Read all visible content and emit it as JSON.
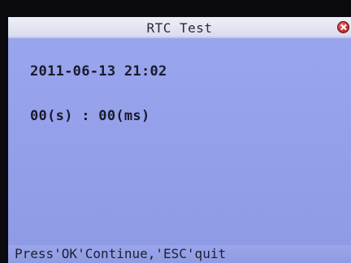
{
  "window": {
    "title": "RTC Test",
    "close_icon": "close-icon"
  },
  "main": {
    "datetime": "2011-06-13 21:02",
    "timer": "00(s) : 00(ms)"
  },
  "status": {
    "hint": "Press'OK'Continue,'ESC'quit"
  },
  "colors": {
    "screen_bg": "#95a1ea",
    "title_bg": "#e6e8f4",
    "close_button": "#c03030"
  }
}
